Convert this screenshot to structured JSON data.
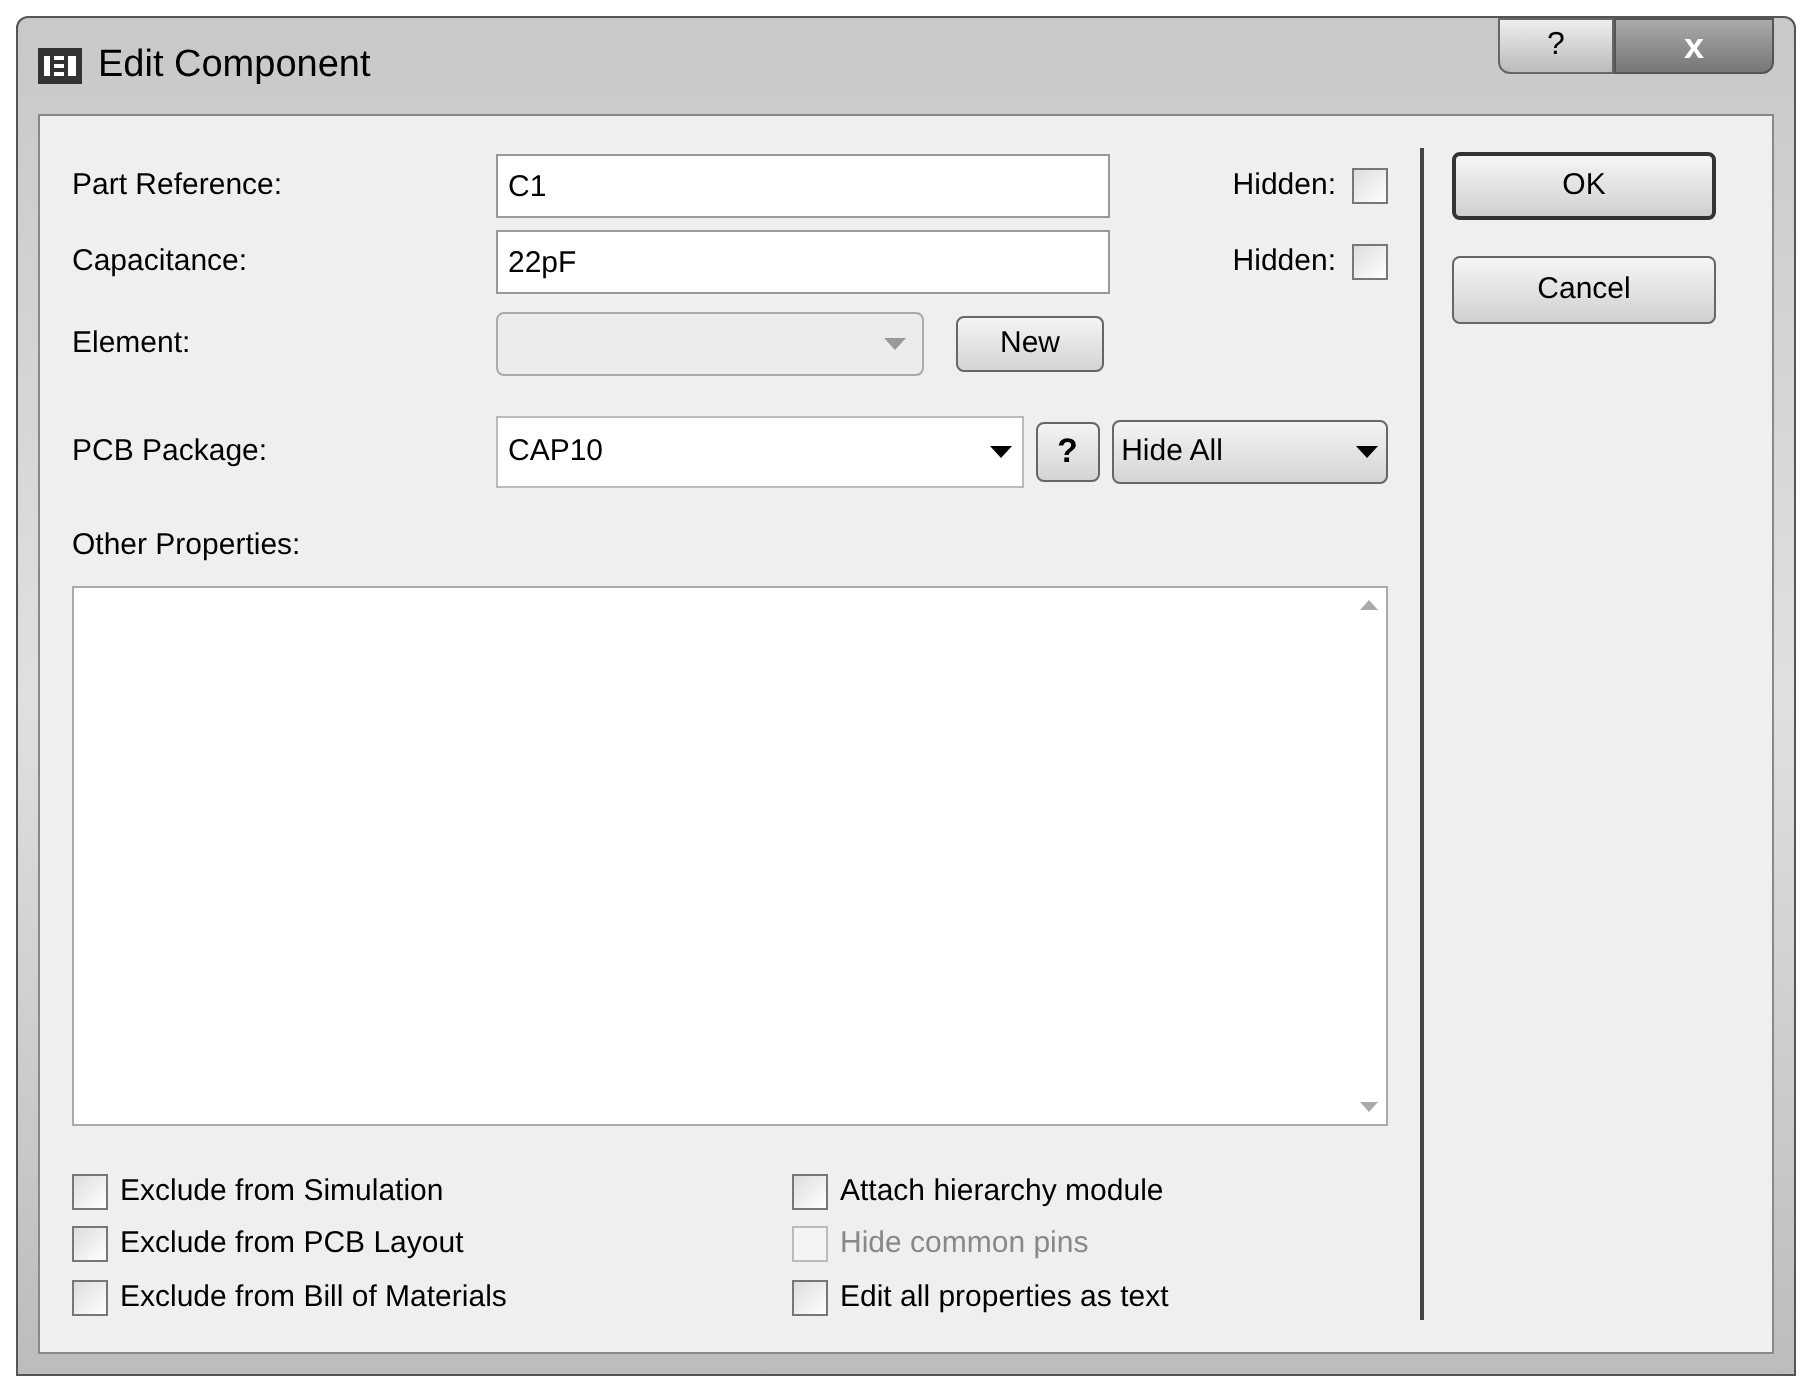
{
  "window": {
    "title": "Edit Component",
    "controls": [
      "?",
      "x"
    ]
  },
  "fields": [
    {
      "kind": "text",
      "label": "Part Reference:",
      "value": "C1",
      "hidden_label": "Hidden:",
      "hidden": false
    },
    {
      "kind": "text",
      "label": "Capacitance:",
      "value": "22pF",
      "hidden_label": "Hidden:",
      "hidden": false
    },
    {
      "kind": "combo",
      "label": "Element:",
      "disabled": true,
      "button": "New"
    },
    {
      "kind": "package",
      "label": "PCB Package:",
      "value": "CAP10",
      "help": "?",
      "visibility": "Hide All"
    }
  ],
  "other_properties": {
    "label": "Other Properties:"
  },
  "options": [
    {
      "label": "Exclude from Simulation",
      "checked": false,
      "disabled": false
    },
    {
      "label": "Attach hierarchy module",
      "checked": false,
      "disabled": false
    },
    {
      "label": "Exclude from PCB Layout",
      "checked": false,
      "disabled": false
    },
    {
      "label": "Hide common pins",
      "checked": false,
      "disabled": true
    },
    {
      "label": "Exclude from Bill of Materials",
      "checked": false,
      "disabled": false
    },
    {
      "label": "Edit all properties as text",
      "checked": false,
      "disabled": false
    }
  ],
  "buttons": [
    {
      "label": "OK",
      "default": true
    },
    {
      "label": "Cancel",
      "default": false
    }
  ]
}
